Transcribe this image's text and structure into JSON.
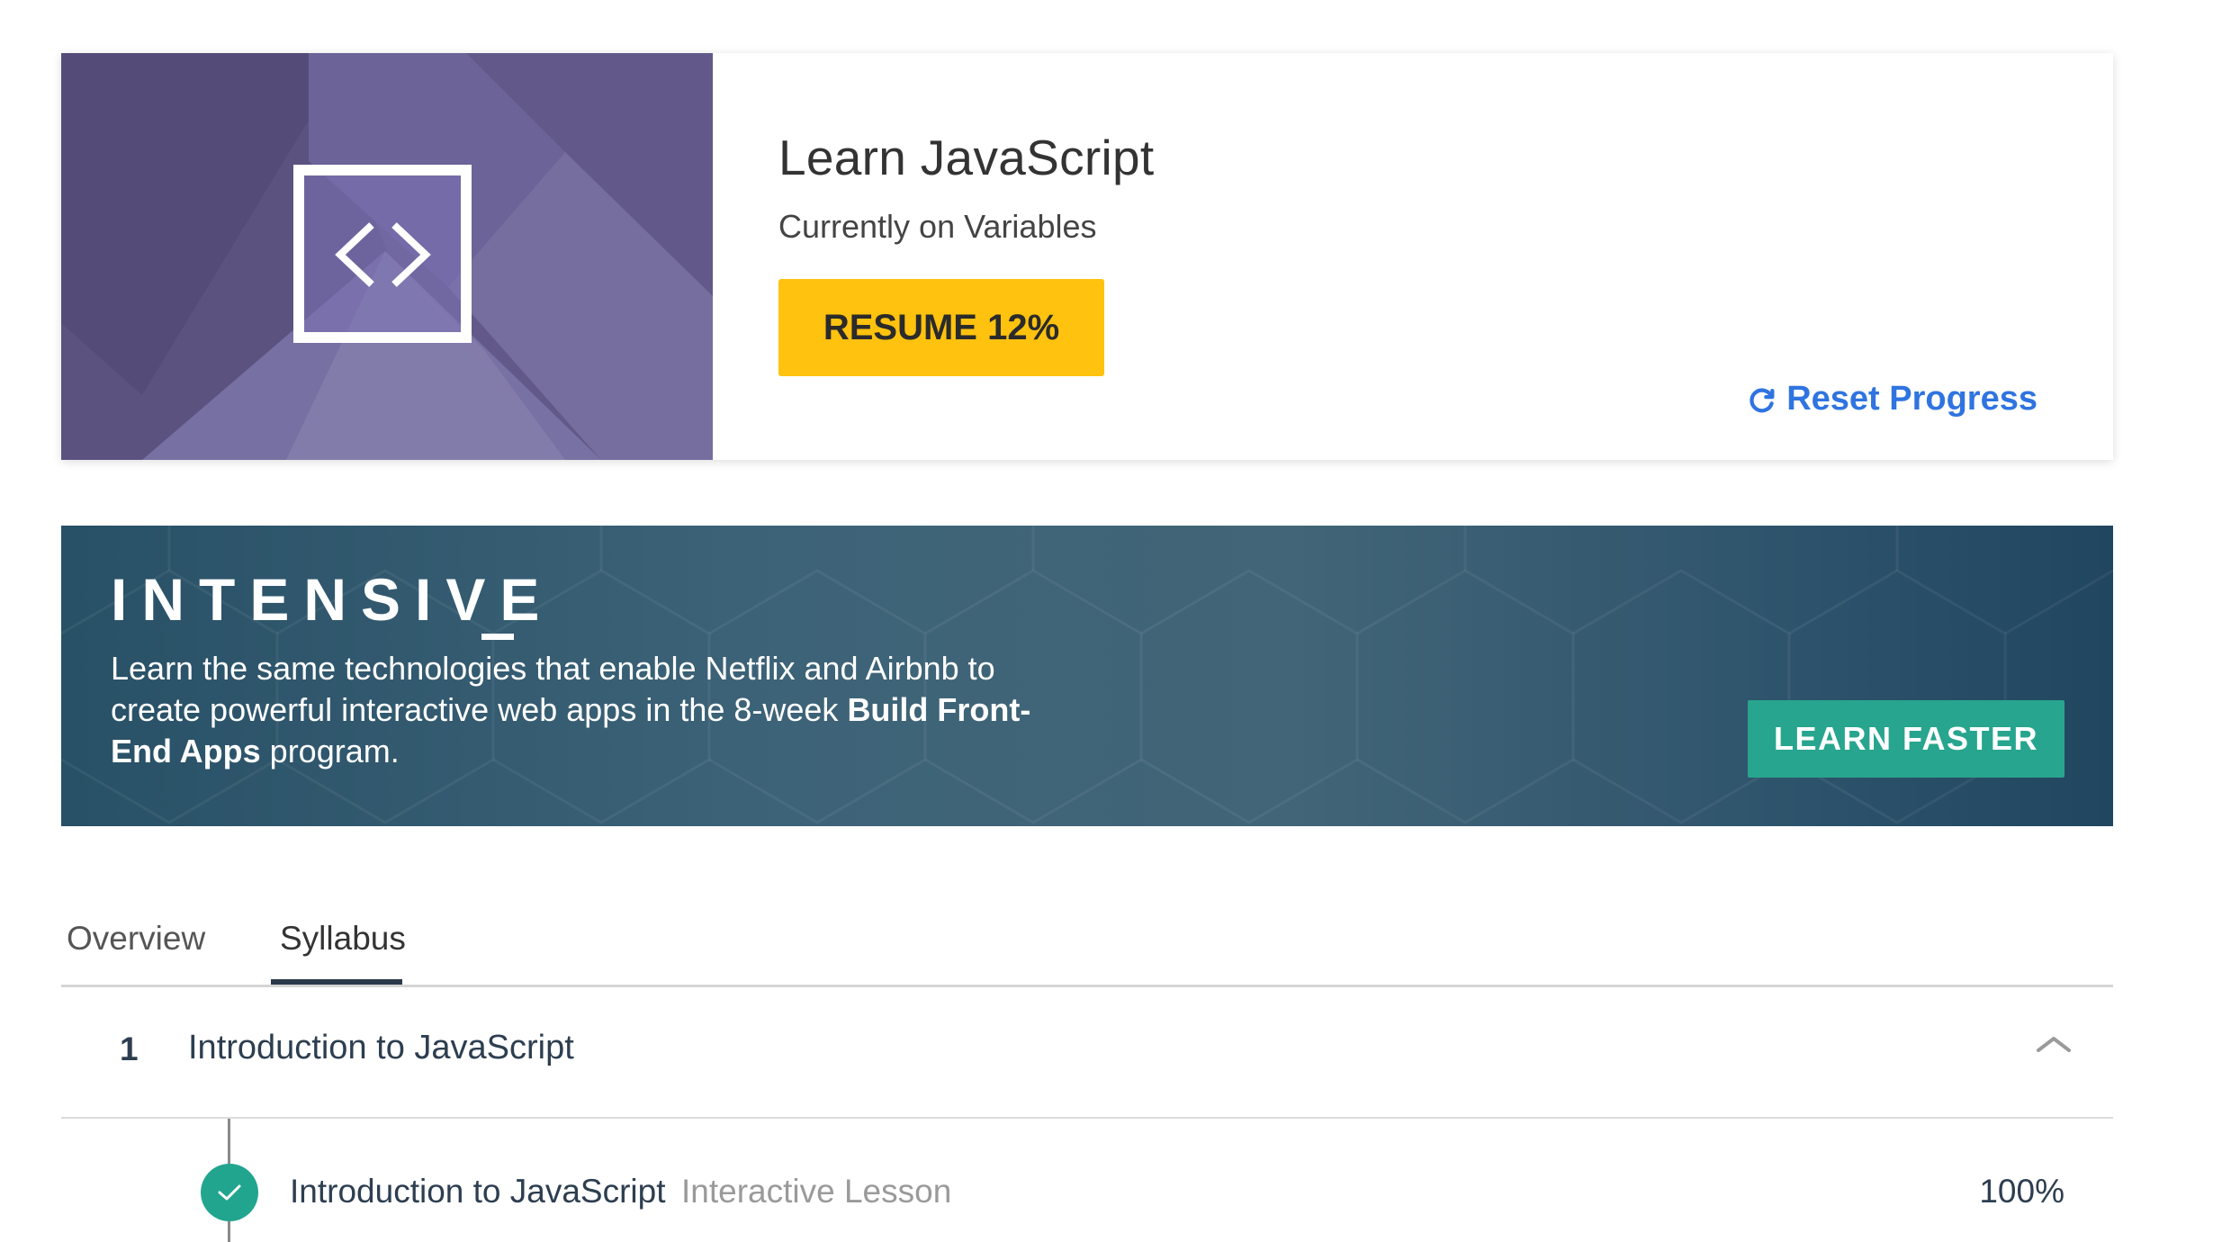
{
  "course": {
    "title": "Learn JavaScript",
    "status": "Currently on Variables",
    "resume_label": "RESUME 12%",
    "progress_percent": 12,
    "reset_label": "Reset Progress",
    "icon": "code-brackets-icon"
  },
  "promo": {
    "brand": "INTENSIVE",
    "text_part1": "Learn the same technologies that enable Netflix and Airbnb to create powerful interactive web apps in the 8-week ",
    "text_bold": "Build Front-End Apps",
    "text_part2": " program.",
    "cta_label": "LEARN FASTER"
  },
  "tabs": [
    {
      "label": "Overview",
      "active": false
    },
    {
      "label": "Syllabus",
      "active": true
    }
  ],
  "syllabus": {
    "sections": [
      {
        "number": "1",
        "title": "Introduction to JavaScript",
        "expanded": true,
        "lessons": [
          {
            "title": "Introduction to JavaScript",
            "type": "Interactive Lesson",
            "progress": "100%",
            "completed": true
          }
        ]
      }
    ]
  },
  "colors": {
    "resume_button": "#ffc20e",
    "reset_link": "#2f74e0",
    "cta_button": "#27a58e",
    "complete_check": "#22a58f",
    "course_art": "#5e5582"
  }
}
